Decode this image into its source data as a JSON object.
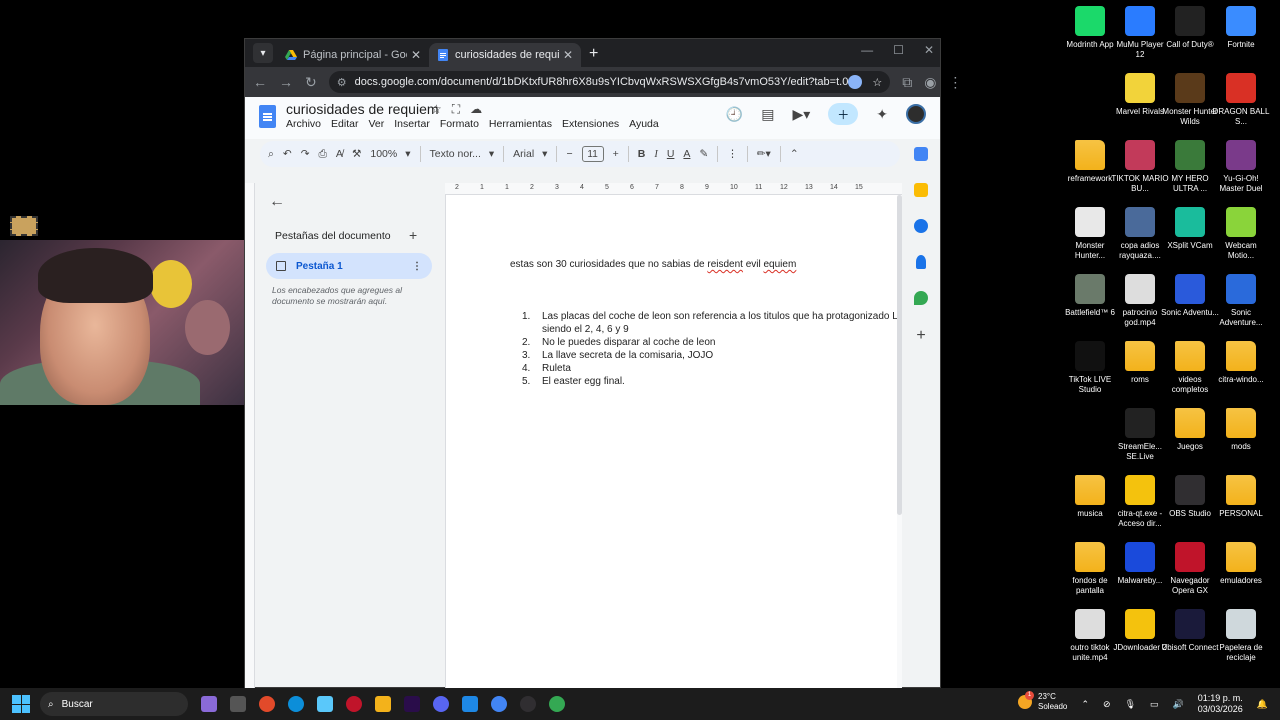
{
  "browser": {
    "tabs": [
      {
        "title": "Página principal - Google Drive",
        "active": false
      },
      {
        "title": "curiosidades de requiem - Doc",
        "active": true
      }
    ],
    "url": "docs.google.com/document/d/1bDKtxfUR8hr6X8u9sYICbvqWxRSWSXGfgB4s7vmO53Y/edit?tab=t.0"
  },
  "docs": {
    "title": "curiosidades de requiem",
    "menu": [
      "Archivo",
      "Editar",
      "Ver",
      "Insertar",
      "Formato",
      "Herramientas",
      "Extensiones",
      "Ayuda"
    ],
    "toolbar": {
      "zoom": "100%",
      "style": "Texto nor...",
      "font": "Arial",
      "size": "11",
      "bold": "B",
      "italic": "I",
      "underline": "U",
      "text_color": "A"
    },
    "outline": {
      "heading": "Pestañas del documento",
      "tab_name": "Pestaña 1",
      "hint": "Los encabezados que agregues al documento se mostrarán aquí."
    },
    "ruler_numbers": [
      "2",
      "1",
      "1",
      "2",
      "3",
      "4",
      "5",
      "6",
      "7",
      "8",
      "9",
      "10",
      "11",
      "12",
      "13",
      "14",
      "15"
    ],
    "body": {
      "intro": {
        "before": "estas son 30 curiosidades que no sabias de ",
        "w1": "reisdent",
        "mid": " evil ",
        "w2": "equiem"
      },
      "items": [
        {
          "num": "1.",
          "text": "Las placas del coche de leon son referencia a los titulos que ha protagonizado Le"
        },
        {
          "num": "",
          "text": "siendo el 2, 4, 6 y 9"
        },
        {
          "num": "2.",
          "text": "No le puedes disparar al coche de leon"
        },
        {
          "num": "3.",
          "text": "La llave secreta de la comisaria, JOJO"
        },
        {
          "num": "4.",
          "text": "Ruleta"
        },
        {
          "num": "5.",
          "text": "El easter egg final."
        }
      ]
    }
  },
  "desktop_icons": [
    {
      "label": "Modrinth App",
      "color": "#1bd96a"
    },
    {
      "label": "MuMu Player 12",
      "color": "#2a7cff"
    },
    {
      "label": "Call of Duty®",
      "color": "#222222"
    },
    {
      "label": "Fortnite",
      "color": "#3a8cff"
    },
    {
      "label": "Marvel Rivals",
      "color": "#f2d33a"
    },
    {
      "label": "Monster Hunter Wilds",
      "color": "#5a3a1a"
    },
    {
      "label": "DRAGON BALL S...",
      "color": "#d93025"
    },
    {
      "label": "reframework",
      "color": "folder"
    },
    {
      "label": "TIKTOK MARIO BU...",
      "color": "#c23a5a"
    },
    {
      "label": "MY HERO ULTRA ...",
      "color": "#3a7a3a"
    },
    {
      "label": "Yu-Gi-Oh! Master Duel",
      "color": "#7a3a8a"
    },
    {
      "label": "Monster Hunter...",
      "color": "#e8e8e8"
    },
    {
      "label": "copa adios rayquaza....",
      "color": "#4a6a9a"
    },
    {
      "label": "XSplit VCam",
      "color": "#1abc9c"
    },
    {
      "label": "Webcam Motio...",
      "color": "#8ad43a"
    },
    {
      "label": "Battlefield™ 6",
      "color": "#6a7a6a"
    },
    {
      "label": "patrocinio god.mp4",
      "color": "#dddddd"
    },
    {
      "label": "Sonic Adventu...",
      "color": "#2a5adb"
    },
    {
      "label": "Sonic Adventure...",
      "color": "#2a6adb"
    },
    {
      "label": "TikTok LIVE Studio",
      "color": "#111111"
    },
    {
      "label": "roms",
      "color": "folder"
    },
    {
      "label": "videos completos",
      "color": "folder"
    },
    {
      "label": "citra-windo...",
      "color": "folder"
    },
    {
      "label": "StreamEle... SE.Live",
      "color": "#222222"
    },
    {
      "label": "Juegos",
      "color": "folder"
    },
    {
      "label": "mods",
      "color": "folder"
    },
    {
      "label": "musica",
      "color": "folder"
    },
    {
      "label": "citra-qt.exe - Acceso dir...",
      "color": "#f4c20d"
    },
    {
      "label": "OBS Studio",
      "color": "#302e31"
    },
    {
      "label": "PERSONAL",
      "color": "folder"
    },
    {
      "label": "fondos de pantalla",
      "color": "folder"
    },
    {
      "label": "Malwareby...",
      "color": "#1a4adb"
    },
    {
      "label": "Navegador Opera GX",
      "color": "#c0142a"
    },
    {
      "label": "emuladores",
      "color": "folder"
    },
    {
      "label": "outro tiktok unite.mp4",
      "color": "#dddddd"
    },
    {
      "label": "JDownloader 2",
      "color": "#f4c20d"
    },
    {
      "label": "Ubisoft Connect",
      "color": "#1a1a3a"
    },
    {
      "label": "Papelera de reciclaje",
      "color": "#cfd8dc"
    }
  ],
  "taskbar": {
    "search": "Buscar",
    "weather_temp": "23°C",
    "weather_desc": "Soleado",
    "weather_badge": "1",
    "time": "01:19 p. m.",
    "date": "03/03/2026"
  }
}
